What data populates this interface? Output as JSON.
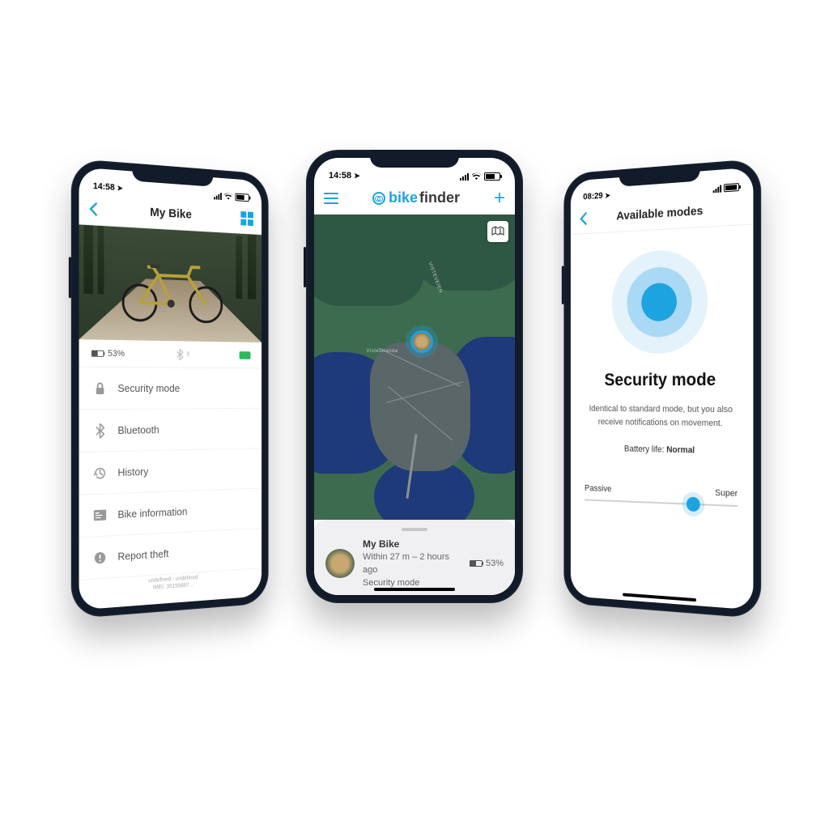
{
  "accent": "#1ca3e0",
  "statusbar": {
    "left": {
      "time": "14:58",
      "battery_pct": 71
    },
    "center": {
      "time": "14:58",
      "battery_pct": 71
    },
    "right": {
      "time": "08:29",
      "battery_pct": 94
    }
  },
  "brand": {
    "prefix": "bike",
    "suffix": "finder"
  },
  "phone_left": {
    "title": "My Bike",
    "battery_text": "53%",
    "menu": {
      "security": "Security mode",
      "bluetooth": "Bluetooth",
      "history": "History",
      "bikeinfo": "Bike information",
      "report": "Report theft"
    },
    "footer_line1": "undefined - undefined",
    "footer_line2": "IMEI: 35155887..."
  },
  "phone_center": {
    "map_labels": {
      "vistestranda": "Vistestranda",
      "visteveien": "VISTEVEIEN"
    },
    "sheet": {
      "name": "My Bike",
      "distance": "Within 27 m",
      "separator": "–",
      "ago": "2 hours ago",
      "mode": "Security mode",
      "battery": "53%"
    }
  },
  "phone_right": {
    "title": "Available modes",
    "mode_title": "Security mode",
    "description": "Identical to standard mode, but you also receive notifications on movement.",
    "battery_label": "Battery life:",
    "battery_value": "Normal",
    "slider": {
      "left_label": "Passive",
      "right_label": "Super",
      "position_pct": 72
    }
  }
}
